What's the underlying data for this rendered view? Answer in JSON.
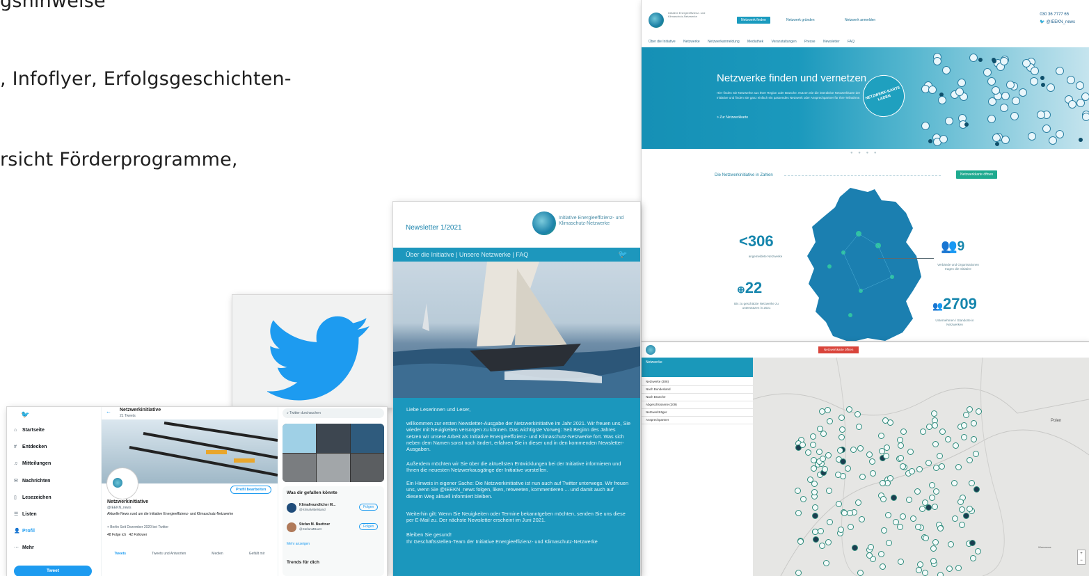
{
  "slide": {
    "lines": [
      "gshinweise",
      ", Infoflyer, Erfolgsgeschichten-",
      "rsicht Förderprogramme,"
    ]
  },
  "website": {
    "logo_text": "Initiative Energieeffizienz- und Klimaschutz-Netzwerke",
    "btn_primary": "Netzwerk finden",
    "btn_2": "Netzwerk gründen",
    "btn_3": "Netzwerk anmelden",
    "phone": "030 36 7777 65",
    "twitter_handle": "@IEEKN_news",
    "nav": [
      "Über die Initiative",
      "Netzwerke",
      "Netzwerkanmeldung",
      "Mediathek",
      "Veranstaltungen",
      "Presse",
      "Newsletter",
      "FAQ"
    ],
    "hero_title": "Netzwerke finden und vernetzen",
    "hero_text": "Hier finden Sie Netzwerke aus Ihrer Region oder Branche. Nutzen Sie die interaktive Netzwerkkarte der Initiative und finden Sie ganz einfach ein passendes Netzwerk oder Ansprechpartner für Ihre Teilnahme.",
    "hero_link": "> Zur Netzwerkkarte",
    "hero_badge": "NETZWERK-KARTE LADEN",
    "section_title": "Die Netzwerkinitiative in Zahlen",
    "map_button": "Netzwerkkarte öffnen",
    "stats": [
      {
        "value": "306",
        "caption": "angemeldete Netzwerke"
      },
      {
        "value": "9",
        "caption": "Verbände und Organisationen tragen die Initiative"
      },
      {
        "value": "22",
        "caption": "Bis zu geschätzte Netzwerke zu unterstützen in 2021"
      },
      {
        "value": "2709",
        "caption": "Unternehmen / Standorte in Netzwerken"
      }
    ]
  },
  "mappanel": {
    "top_button": "Netzwerkkarte öffnen",
    "side_title": "Netzwerke",
    "side_filters": [
      "Netzwerke (306)",
      "Nach Bundesland",
      "Nach Branche",
      "Abgeschlossene (209)",
      "Netzwerkträger",
      "Ansprechpartner"
    ],
    "country_label": "Polen",
    "city_label": "Warszawa",
    "zoom_plus": "+",
    "zoom_minus": "−"
  },
  "newsletter": {
    "title": "Newsletter 1/2021",
    "logo_text": "Initiative Energieeffizienz- und Klimaschutz-Netzwerke",
    "nav": "Über die Initiative  |  Unsere Netzwerke  |  FAQ",
    "greeting": "Liebe Leserinnen und Leser,",
    "p1": "willkommen zur ersten Newsletter-Ausgabe der Netzwerkinitiative im Jahr 2021. Wir freuen uns, Sie wieder mit Neuigkeiten versorgen zu können. Das wichtigste Vorweg: Seit Beginn des Jahres setzen wir unsere Arbeit als Initiative Energieeffizienz- und Klimaschutz-Netzwerke fort. Was sich neben dem Namen sonst noch ändert, erfahren Sie in dieser und in den kommenden Newsletter-Ausgaben.",
    "p2": "Außerdem möchten wir Sie über die aktuellsten Entwicklungen bei der Initiative informieren und Ihnen die neuesten Netzwerkausgänge der Initiative vorstellen.",
    "p3": "Ein Hinweis in eigener Sache: Die Netzwerkinitiative ist nun auch auf Twitter unterwegs. Wir freuen uns, wenn Sie @IEEKN_news folgen, liken, retweeten, kommentieren ... und damit auch auf diesem Weg aktuell informiert bleiben.",
    "p4": "Weiterhin gilt: Wenn Sie Neuigkeiten oder Termine bekanntgeben möchten, senden Sie uns diese per E-Mail zu. Der nächste Newsletter erscheint im Juni 2021.",
    "p5": "Bleiben Sie gesund!",
    "p6": "Ihr Geschäftsstellen-Team der Initiative Energieeffizienz- und Klimaschutz-Netzwerke"
  },
  "twitter": {
    "nav": [
      "Startseite",
      "Entdecken",
      "Mitteilungen",
      "Nachrichten",
      "Lesezeichen",
      "Listen",
      "Profil",
      "Mehr"
    ],
    "tweet_button": "Tweet",
    "header_name": "Netzwerkinitiative",
    "header_sub": "21 Tweets",
    "edit_profile": "Profil bearbeiten",
    "name": "Netzwerkinitiative",
    "handle": "@IEEKN_news",
    "bio": "Aktuelle News rund um die Initiative Energieeffizienz- und Klimaschutz-Netzwerke",
    "meta": "Berlin   Seit Dezember 2020 bei Twitter",
    "following": "48 Folge ich",
    "followers": "42 Follower",
    "tabs": [
      "Tweets",
      "Tweets und Antworten",
      "Medien",
      "Gefällt mir"
    ],
    "search_placeholder": "Twitter durchsuchen",
    "suggest_title": "Was dir gefallen könnte",
    "suggest": [
      {
        "name": "Klimafreundlicher M...",
        "handle": "@KlimaMittelstand",
        "btn": "Folgen"
      },
      {
        "name": "Stefan M. Buettner",
        "handle": "@StefanMBuett",
        "btn": "Folgen"
      }
    ],
    "more": "Mehr anzeigen",
    "trends": "Trends für dich"
  },
  "colors": {
    "brand_blue": "#1b97bd",
    "twitter_blue": "#1d9bf0",
    "green": "#1eaa8f"
  }
}
